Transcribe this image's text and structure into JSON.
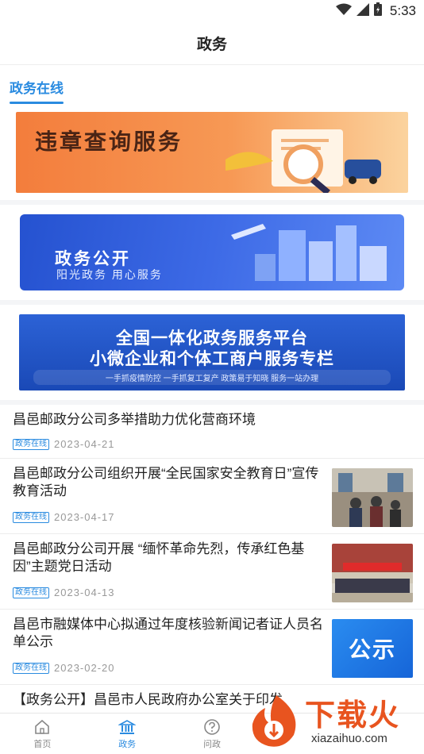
{
  "status_bar": {
    "time": "5:33"
  },
  "header": {
    "title": "政务"
  },
  "section": {
    "tab_label": "政务在线"
  },
  "banners": [
    {
      "text": "违章查询服务"
    },
    {
      "text": "政务公开",
      "subtext": "阳光政务  用心服务"
    },
    {
      "line1": "全国一体化政务服务平台",
      "line2": "小微企业和个体工商户服务专栏",
      "line3": "一手抓疫情防控  一手抓复工复产  政策易于知晓  服务一站办理"
    }
  ],
  "news": [
    {
      "title": "昌邑邮政分公司多举措助力优化营商环境",
      "tag": "政务在线",
      "date": "2023-04-21"
    },
    {
      "title": "昌邑邮政分公司组织开展“全民国家安全教育日”宣传教育活动",
      "tag": "政务在线",
      "date": "2023-04-17"
    },
    {
      "title": "昌邑邮政分公司开展 “缅怀革命先烈，传承红色基因”主题党日活动",
      "tag": "政务在线",
      "date": "2023-04-13"
    },
    {
      "title": "昌邑市融媒体中心拟通过年度核验新闻记者证人员名单公示",
      "tag": "政务在线",
      "date": "2023-02-20",
      "thumb_text": "公示"
    },
    {
      "title": "【政务公开】昌邑市人民政府办公室关于印发"
    }
  ],
  "nav": [
    {
      "label": "首页",
      "icon": "home-icon"
    },
    {
      "label": "政务",
      "icon": "government-building-icon",
      "active": true
    },
    {
      "label": "问政",
      "icon": "question-icon"
    }
  ],
  "watermark": {
    "text": "下载火",
    "url_text": "xiazaihuo.com"
  },
  "colors": {
    "accent": "#2a8be0",
    "watermark": "#e8541f"
  }
}
